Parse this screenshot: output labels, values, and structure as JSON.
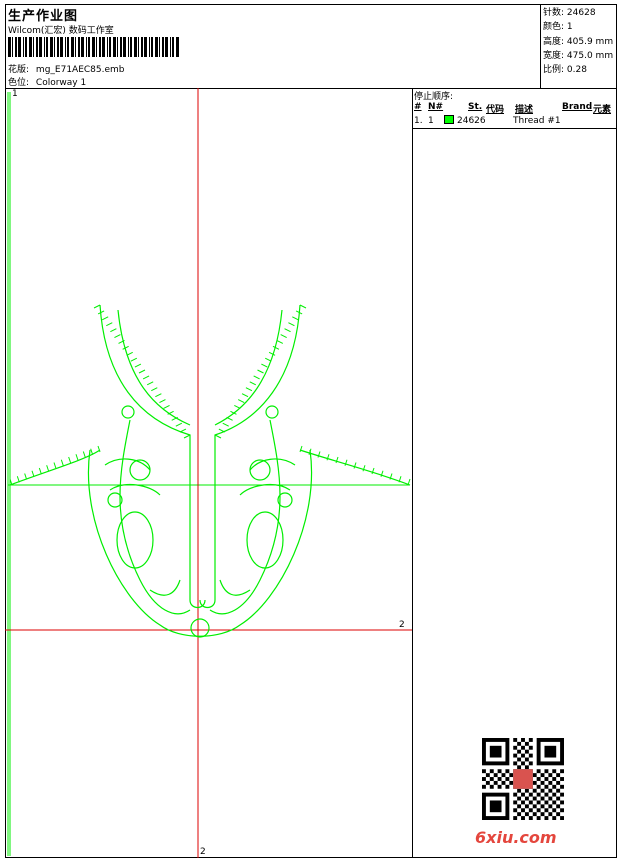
{
  "header": {
    "title": "生产作业图",
    "subtitle": "Wilcom(汇宏) 数码工作室",
    "pattern_label": "花版:",
    "pattern_value": "mg_E71AEC85.emb",
    "color_label": "色位:",
    "color_value": "Colorway 1"
  },
  "stats": {
    "stitches_label": "针数:",
    "stitches_value": "24628",
    "colors_label": "颜色:",
    "colors_value": "1",
    "height_label": "高度:",
    "height_value": "405.9 mm",
    "width_label": "宽度:",
    "width_value": "475.0 mm",
    "scale_label": "比例:",
    "scale_value": "0.28"
  },
  "stop_sequence": {
    "heading": "停止顺序:",
    "columns": [
      "#",
      "N#",
      "St.",
      "代码",
      "描述",
      "Brand",
      "元素"
    ],
    "rows": [
      {
        "num": "1.",
        "n": "1",
        "code": "24626",
        "desc": "Thread #1",
        "color": "#00ff00"
      }
    ]
  },
  "guides": {
    "h_label": "2",
    "v_label": "2",
    "corner_label": "1"
  },
  "colors": {
    "guide_red": "#dd0000",
    "thread_green": "#00ee00",
    "watermark": "#e4463d"
  },
  "watermark": "6xiu.com"
}
